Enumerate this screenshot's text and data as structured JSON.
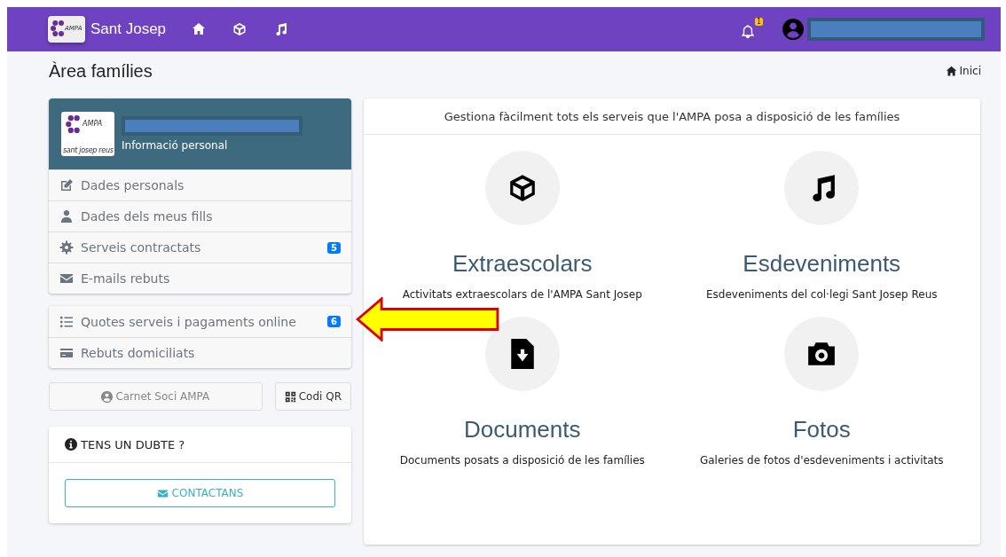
{
  "navbar": {
    "logo_text": "AMPA",
    "brand": "Sant Josep",
    "notification_count": "1"
  },
  "page": {
    "title": "Àrea famílies",
    "breadcrumb": "Inici"
  },
  "profile": {
    "logo_text": "AMPA",
    "logo_subtext": "sant josep reus",
    "subtitle": "Informació personal"
  },
  "menu_groups": [
    [
      {
        "label": "Dades personals"
      },
      {
        "label": "Dades dels meus fills"
      },
      {
        "label": "Serveis contractats",
        "badge": "5"
      },
      {
        "label": "E-mails rebuts"
      }
    ],
    [
      {
        "label": "Quotes serveis i pagaments online",
        "badge": "6"
      },
      {
        "label": "Rebuts domiciliats"
      }
    ]
  ],
  "buttons": [
    {
      "label": "Carnet Soci AMPA",
      "disabled": true
    },
    {
      "label": "Codi QR",
      "disabled": false
    }
  ],
  "help": {
    "title": "TENS UN DUBTE ?",
    "button": "CONTACTANS"
  },
  "services": {
    "intro": "Gestiona fàcilment tots els serveis que l'AMPA posa a disposició de les famílies",
    "tiles": [
      {
        "title": "Extraescolars",
        "description": "Activitats extraescolars de l'AMPA Sant Josep"
      },
      {
        "title": "Esdeveniments",
        "description": "Esdeveniments del col·legi Sant Josep Reus"
      },
      {
        "title": "Documents",
        "description": "Documents posats a disposició de les famílies"
      },
      {
        "title": "Fotos",
        "description": "Galeries de fotos d'esdeveniments i activitats"
      }
    ]
  }
}
